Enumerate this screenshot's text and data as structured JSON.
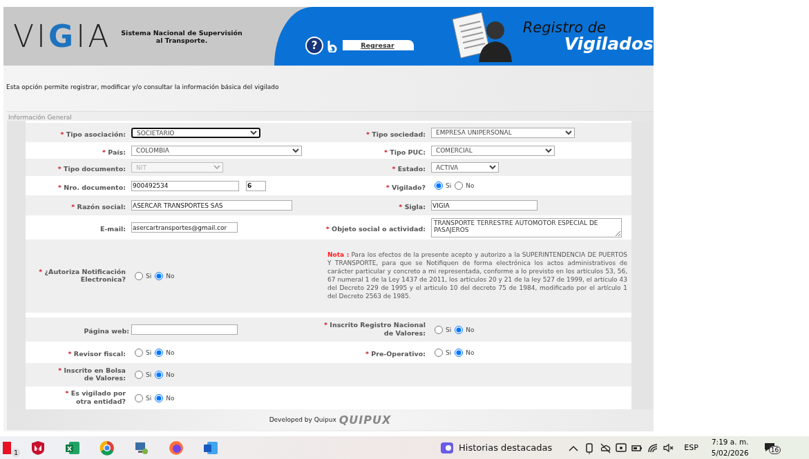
{
  "header": {
    "logo": [
      "VI",
      "G",
      "IA"
    ],
    "subtitle_lines": [
      "Sistema Nacional de Supervisión",
      "al Transporte."
    ],
    "help_icon": "?",
    "back_link": "Regresar",
    "title_lines": [
      "Registro de",
      "Vigilados"
    ]
  },
  "intro": "Esta opción permite registrar, modificar y/o consultar la información básica del vigilado",
  "section": {
    "legend": "Información General",
    "rows": [
      {
        "left": {
          "kind": "select",
          "required_mark": "*",
          "label": "Tipo asociación:",
          "value": "SOCIETARIO",
          "focused": true,
          "disabled": false
        },
        "right": {
          "kind": "select",
          "required_mark": "*",
          "label": "Tipo sociedad:",
          "value": "EMPRESA UNIPERSONAL",
          "focused": false,
          "disabled": false
        }
      },
      {
        "left": {
          "kind": "select",
          "required_mark": "*",
          "label": "País:",
          "value": "COLOMBIA",
          "focused": false,
          "disabled": false
        },
        "right": {
          "kind": "select",
          "required_mark": "*",
          "label": "Tipo PUC:",
          "value": "COMERCIAL",
          "focused": false,
          "disabled": false
        }
      },
      {
        "left": {
          "kind": "select",
          "required_mark": "*",
          "label": "Tipo documento:",
          "value": "NIT",
          "focused": false,
          "disabled": true
        },
        "right": {
          "kind": "select",
          "required_mark": "*",
          "label": "Estado:",
          "value": "ACTIVA",
          "focused": false,
          "disabled": false
        }
      },
      {
        "left": {
          "kind": "document",
          "required_mark": "*",
          "label": "Nro. documento:",
          "value": "900492534",
          "check_digit": "6"
        },
        "right": {
          "kind": "radio",
          "required_mark": "*",
          "label": "Vigilado?",
          "options": [
            {
              "label": "Si",
              "selected": true
            },
            {
              "label": "No",
              "selected": false
            }
          ]
        }
      },
      {
        "left": {
          "kind": "text",
          "required_mark": "*",
          "label": "Razón social:",
          "value": "ASERCAR TRANSPORTES SAS"
        },
        "right": {
          "kind": "text",
          "required_mark": "*",
          "label": "Sigla:",
          "value": "VIGIA"
        }
      },
      {
        "left": {
          "kind": "text",
          "label": "E-mail:",
          "value": "asercartransportes@gmail.cor"
        },
        "right": {
          "kind": "textarea",
          "required_mark": "*",
          "label": "Objeto social o actividad:",
          "value": "TRANSPORTE TERRESTRE AUTOMOTOR ESPECIAL DE PASAJEROS"
        }
      },
      {
        "left": {
          "kind": "radio",
          "required_mark": "*",
          "label": "¿Autoriza Notificación Electronica?",
          "options": [
            {
              "label": "Si",
              "selected": false
            },
            {
              "label": "No",
              "selected": true
            }
          ]
        },
        "right": {
          "kind": "note",
          "text": "**Nota :** Para los efectos de la presente acepto y autorizo a la SUPERINTENDENCIA DE PUERTOS Y TRANSPORTE, para que se Notifiquen de forma electrónica los actos administrativos de carácter particular y concreto a mi representada, conforme a lo previsto en los artículos 53, 56, 67 numeral 1 de la Ley 1437 de 2011, los artículos 20 y 21 de la ley 527 de 1999, el artículo 43 del Decreto 229 de 1995 y el articulo 10 del decreto 75 de 1984, modificado por el artículo 1 del Decreto 2563 de 1985."
        }
      },
      {
        "left": {
          "kind": "text",
          "label": "Página web:"
        },
        "right": {
          "kind": "radio",
          "required_mark": "*",
          "label": "Inscrito Registro Nacional de Valores:",
          "options": [
            {
              "label": "Si",
              "selected": false
            },
            {
              "label": "No",
              "selected": true
            }
          ]
        }
      },
      {
        "left": {
          "kind": "radio",
          "required_mark": "*",
          "label": "Revisor fiscal:",
          "options": [
            {
              "label": "Si",
              "selected": false
            },
            {
              "label": "No",
              "selected": true
            }
          ]
        },
        "right": {
          "kind": "radio",
          "required_mark": "*",
          "label": "Pre-Operativo:",
          "options": [
            {
              "label": "Si",
              "selected": false
            },
            {
              "label": "No",
              "selected": true
            }
          ]
        }
      },
      {
        "left": {
          "kind": "radio",
          "required_mark": "*",
          "label": "Inscrito en Bolsa de Valores:",
          "options": [
            {
              "label": "Si",
              "selected": false
            },
            {
              "label": "No",
              "selected": true
            }
          ]
        }
      },
      {
        "left": {
          "kind": "radio",
          "required_mark": "*",
          "label": "Es vigilado por otra entidad?",
          "options": [
            {
              "label": "Si",
              "selected": false
            },
            {
              "label": "No",
              "selected": true
            }
          ]
        }
      }
    ]
  },
  "footer": {
    "credit": "Developed by Quipux",
    "brand": "QUIPUX"
  },
  "taskbar": {
    "app_badge": "1",
    "news": "Historias destacadas",
    "language": "ESP",
    "time": "7:19 a. m.",
    "date": "5/02/2026",
    "notification_count": "16"
  }
}
